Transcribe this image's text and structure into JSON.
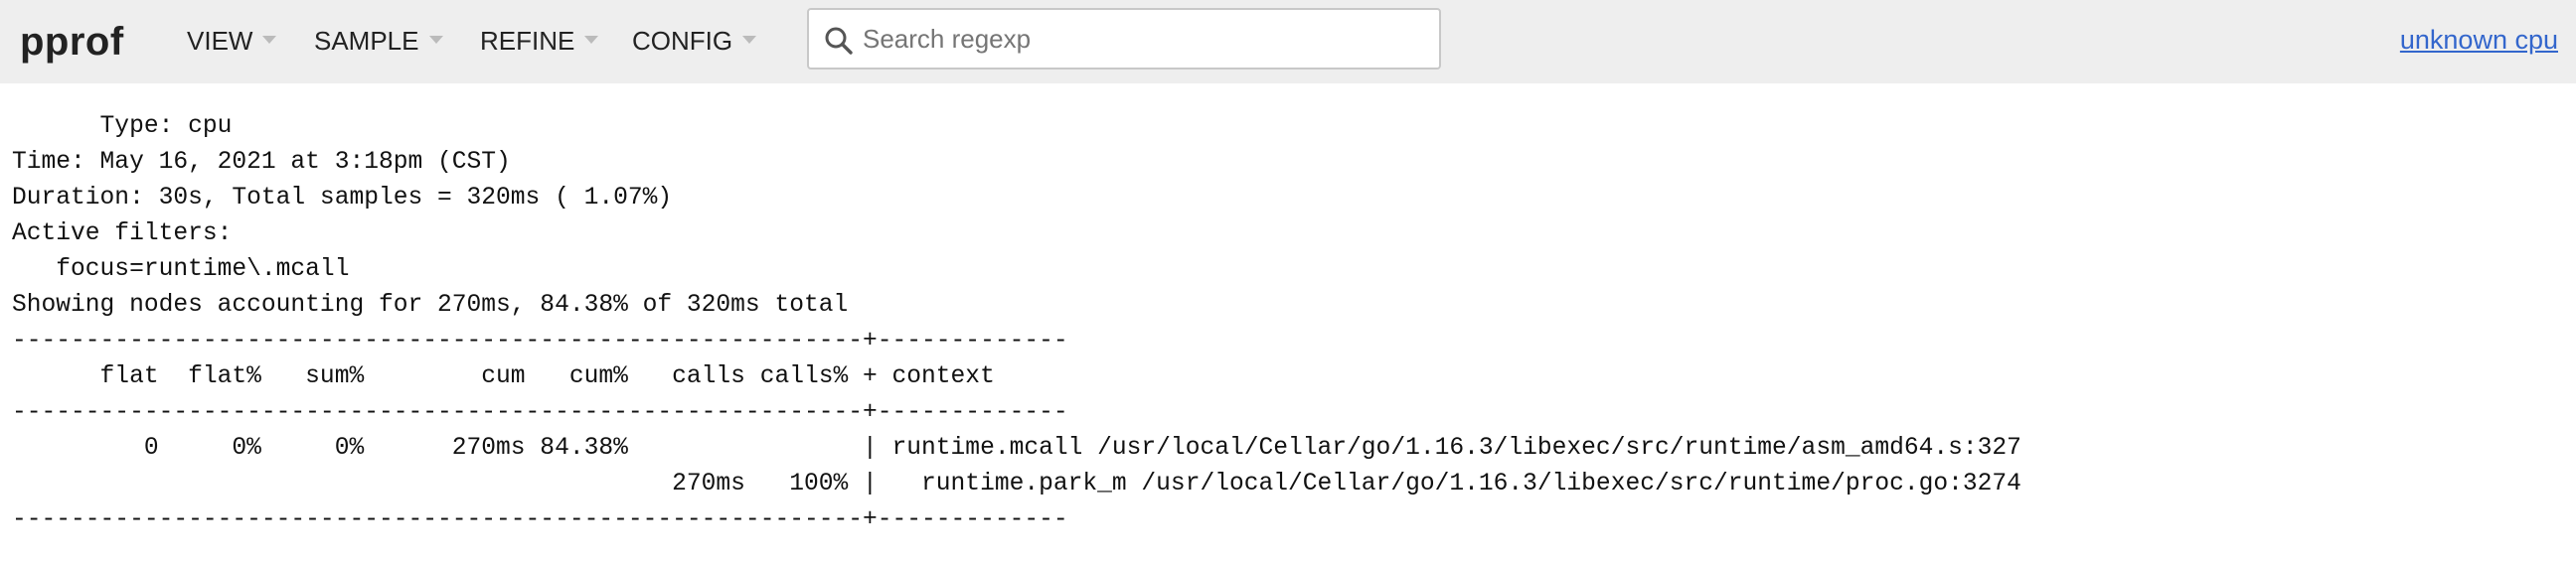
{
  "header": {
    "logo": "pprof",
    "menus": [
      {
        "label": "VIEW"
      },
      {
        "label": "SAMPLE"
      },
      {
        "label": "REFINE"
      },
      {
        "label": "CONFIG"
      }
    ],
    "search": {
      "placeholder": "Search regexp",
      "value": "",
      "icon": "search-icon"
    },
    "cpu_link": "unknown cpu"
  },
  "report": {
    "type_line": "      Type: cpu",
    "time_line": "Time: May 16, 2021 at 3:18pm (CST)",
    "duration_line": "Duration: 30s, Total samples = 320ms ( 1.07%)",
    "filters_heading": "Active filters:",
    "filter_line": "   focus=runtime\\.mcall",
    "summary_line": "Showing nodes accounting for 270ms, 84.38% of 320ms total",
    "separator": "----------------------------------------------------------+-------------",
    "column_header": "      flat  flat%   sum%        cum   cum%   calls calls% + context",
    "rows": [
      "         0     0%     0%      270ms 84.38%                | runtime.mcall /usr/local/Cellar/go/1.16.3/libexec/src/runtime/asm_amd64.s:327",
      "                                             270ms   100% |   runtime.park_m /usr/local/Cellar/go/1.16.3/libexec/src/runtime/proc.go:3274"
    ]
  }
}
